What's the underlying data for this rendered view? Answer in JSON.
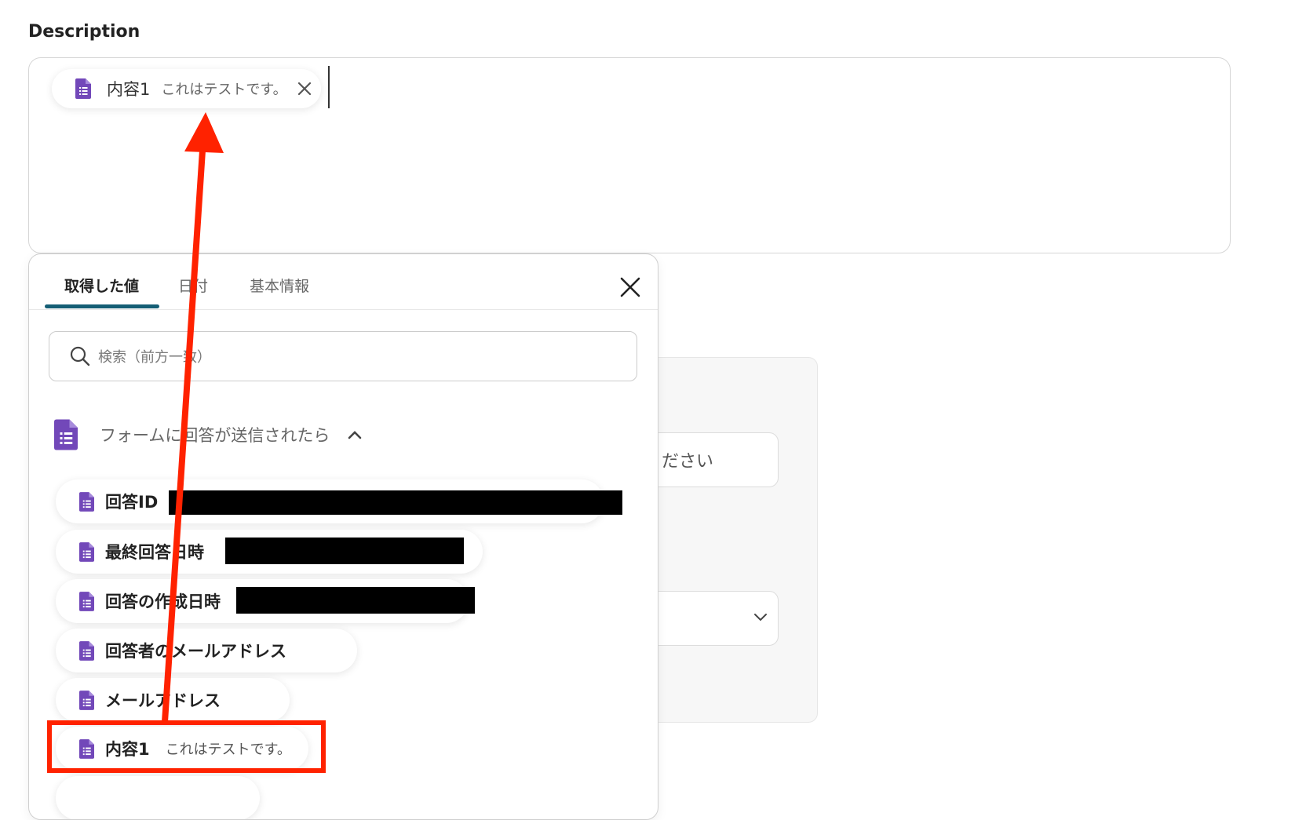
{
  "description": {
    "label": "Description",
    "chip": {
      "name": "内容1",
      "value": "これはテストです。"
    }
  },
  "background_form": {
    "hint_text": "ださい"
  },
  "popup": {
    "tabs": [
      {
        "label": "取得した値",
        "active": true
      },
      {
        "label": "日付",
        "active": false
      },
      {
        "label": "基本情報",
        "active": false
      }
    ],
    "search_placeholder": "検索（前方一致）",
    "group": {
      "title": "フォームに回答が送信されたら",
      "items": [
        {
          "label": "回答ID",
          "value": "",
          "redacted": true
        },
        {
          "label": "最終回答日時",
          "value": "",
          "redacted": true
        },
        {
          "label": "回答の作成日時",
          "value": "",
          "redacted": true
        },
        {
          "label": "回答者のメールアドレス",
          "value": ""
        },
        {
          "label": "メールアドレス",
          "value": ""
        },
        {
          "label": "内容1",
          "value": "これはテストです。",
          "highlighted": true
        }
      ]
    }
  },
  "colors": {
    "accent": "#155e75",
    "forms_icon": "#7248b9",
    "annotation": "#ff2200"
  },
  "icons": [
    "google-forms-doc-icon",
    "close-icon",
    "search-icon",
    "chevron-up-icon",
    "chevron-down-icon"
  ]
}
